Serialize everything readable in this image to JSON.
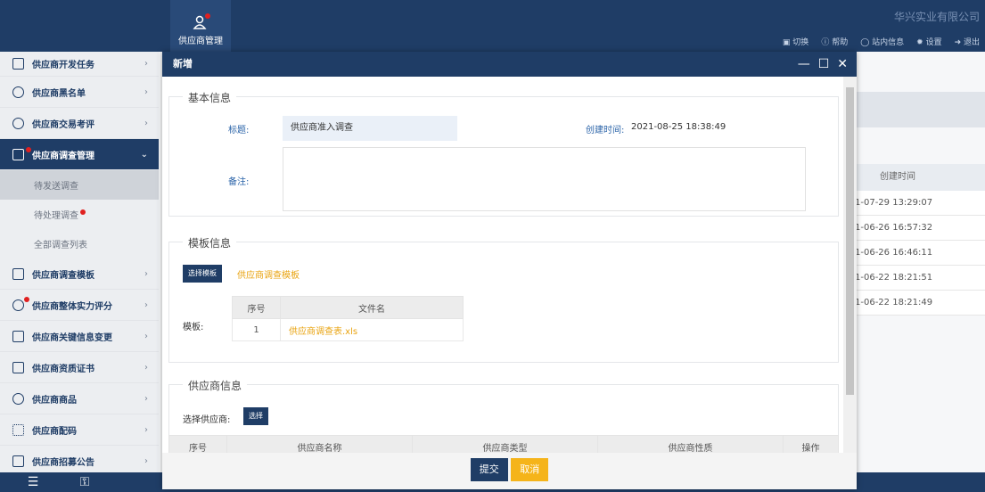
{
  "topbar": {
    "module_label": "供应商管理",
    "company": "华兴实业有限公司",
    "menu": {
      "switch": "切换",
      "help": "帮助",
      "messages": "站内信息",
      "settings": "设置",
      "logout": "退出"
    }
  },
  "sidebar": {
    "items": [
      {
        "label": "供应商开发任务",
        "icon": "chart-icon"
      },
      {
        "label": "供应商黑名单",
        "icon": "user-icon"
      },
      {
        "label": "供应商交易考评",
        "icon": "gear-icon"
      },
      {
        "label": "供应商调查管理",
        "icon": "document-icon"
      },
      {
        "label": "供应商调查模板",
        "icon": "template-icon"
      },
      {
        "label": "供应商整体实力评分",
        "icon": "star-icon"
      },
      {
        "label": "供应商关键信息变更",
        "icon": "edit-icon"
      },
      {
        "label": "供应商资质证书",
        "icon": "certificate-icon"
      },
      {
        "label": "供应商商品",
        "icon": "box-icon"
      },
      {
        "label": "供应商配码",
        "icon": "barcode-icon"
      },
      {
        "label": "供应商招募公告",
        "icon": "notice-icon"
      }
    ],
    "sub_items": [
      {
        "label": "待发送调查"
      },
      {
        "label": "待处理调查"
      },
      {
        "label": "全部调查列表"
      }
    ]
  },
  "background_table": {
    "header": "创建时间",
    "rows": [
      "1-07-29 13:29:07",
      "1-06-26 16:57:32",
      "1-06-26 16:46:11",
      "1-06-22 18:21:51",
      "1-06-22 18:21:49"
    ]
  },
  "modal": {
    "title": "新增",
    "basic": {
      "legend": "基本信息",
      "title_label": "标题:",
      "title_value": "供应商准入调查",
      "created_label": "创建时间:",
      "created_value": "2021-08-25 18:38:49",
      "remark_label": "备注:"
    },
    "template": {
      "legend": "模板信息",
      "select_button": "选择模板",
      "template_name": "供应商调查模板",
      "field_label": "模板:",
      "columns": [
        "序号",
        "文件名"
      ],
      "rows": [
        {
          "no": "1",
          "file": "供应商调查表.xls"
        }
      ]
    },
    "supplier": {
      "legend": "供应商信息",
      "select_label": "选择供应商:",
      "select_button": "选择",
      "columns": [
        "序号",
        "供应商名称",
        "供应商类型",
        "供应商性质",
        "操作"
      ]
    },
    "submit": "提交",
    "cancel": "取消"
  }
}
